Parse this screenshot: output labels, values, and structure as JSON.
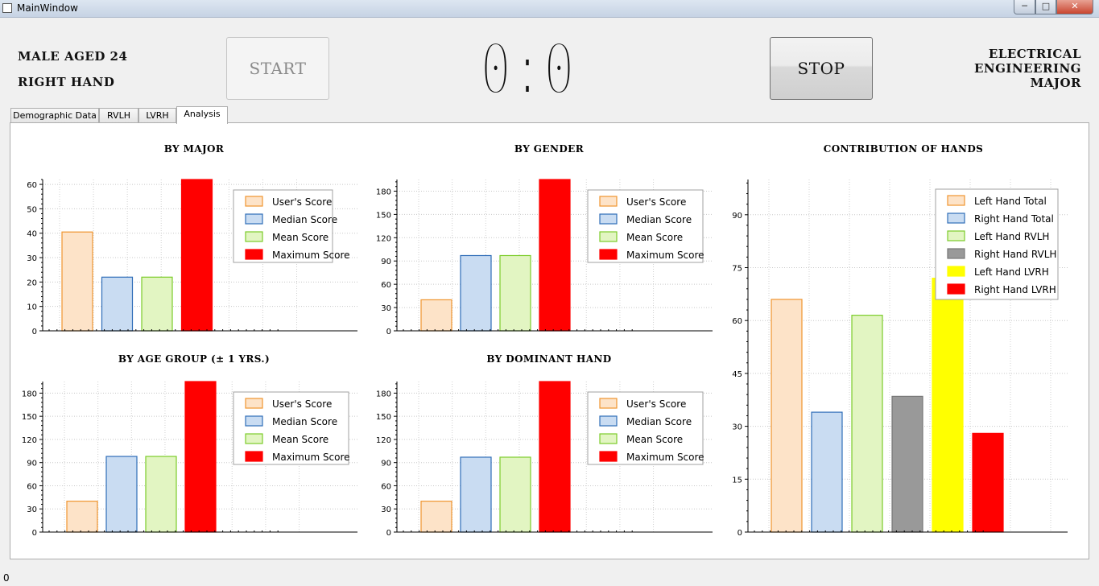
{
  "window": {
    "title": "MainWindow",
    "minimize": "─",
    "maximize": "□",
    "close": "✕"
  },
  "header": {
    "left_line1": "MALE AGED 24",
    "left_line2": "RIGHT HAND",
    "start_label": "START",
    "stop_label": "STOP",
    "score_display": "0:0",
    "right_line1": "ELECTRICAL",
    "right_line2": "ENGINEERING",
    "right_line3": "MAJOR"
  },
  "tabs": [
    "Demographic Data",
    "RVLH",
    "LVRH",
    "Analysis"
  ],
  "active_tab": "Analysis",
  "status_text": "0",
  "chart_data": [
    {
      "type": "bar",
      "title": "BY MAJOR",
      "categories": [
        "User's Score",
        "Median Score",
        "Mean Score",
        "Maximum Score"
      ],
      "values": [
        40.5,
        22,
        22,
        62
      ],
      "ylim": [
        0,
        62
      ],
      "ticks": [
        0,
        10,
        20,
        30,
        40,
        50,
        60
      ],
      "grid": true,
      "legend": "top-right"
    },
    {
      "type": "bar",
      "title": "BY GENDER",
      "categories": [
        "User's Score",
        "Median Score",
        "Mean Score",
        "Maximum Score"
      ],
      "values": [
        40,
        97,
        97,
        195
      ],
      "ylim": [
        0,
        195
      ],
      "ticks": [
        0,
        30,
        60,
        90,
        120,
        150,
        180
      ],
      "grid": true,
      "legend": "top-right"
    },
    {
      "type": "bar",
      "title": "CONTRIBUTION OF HANDS",
      "categories": [
        "Left Hand Total",
        "Right Hand Total",
        "Left Hand RVLH",
        "Right Hand RVLH",
        "Left Hand LVRH",
        "Right Hand LVRH"
      ],
      "values": [
        66,
        34,
        61.5,
        38.5,
        72,
        28
      ],
      "ylim": [
        0,
        100
      ],
      "ticks": [
        0,
        15,
        30,
        45,
        60,
        75,
        90
      ],
      "grid": true,
      "legend": "top-right"
    },
    {
      "type": "bar",
      "title": "BY AGE GROUP (± 1 YRS.)",
      "categories": [
        "User's Score",
        "Median Score",
        "Mean Score",
        "Maximum Score"
      ],
      "values": [
        40,
        98,
        98,
        195
      ],
      "ylim": [
        0,
        195
      ],
      "ticks": [
        0,
        30,
        60,
        90,
        120,
        150,
        180
      ],
      "grid": true,
      "legend": "top-right"
    },
    {
      "type": "bar",
      "title": "BY DOMINANT HAND",
      "categories": [
        "User's Score",
        "Median Score",
        "Mean Score",
        "Maximum Score"
      ],
      "values": [
        40,
        97,
        97,
        195
      ],
      "ylim": [
        0,
        195
      ],
      "ticks": [
        0,
        30,
        60,
        90,
        120,
        150,
        180
      ],
      "grid": true,
      "legend": "top-right"
    }
  ],
  "colors": {
    "users": {
      "fill": "#fde3c8",
      "stroke": "#f0952f"
    },
    "median": {
      "fill": "#c9dcf2",
      "stroke": "#2f6db8"
    },
    "mean": {
      "fill": "#e2f5c2",
      "stroke": "#7ccc2a"
    },
    "maximum": {
      "fill": "#ff0000",
      "stroke": "#ff0000"
    },
    "right_rvlh": {
      "fill": "#999999",
      "stroke": "#777777"
    },
    "left_lvrh": {
      "fill": "#ffff00",
      "stroke": "#ffff00"
    }
  }
}
